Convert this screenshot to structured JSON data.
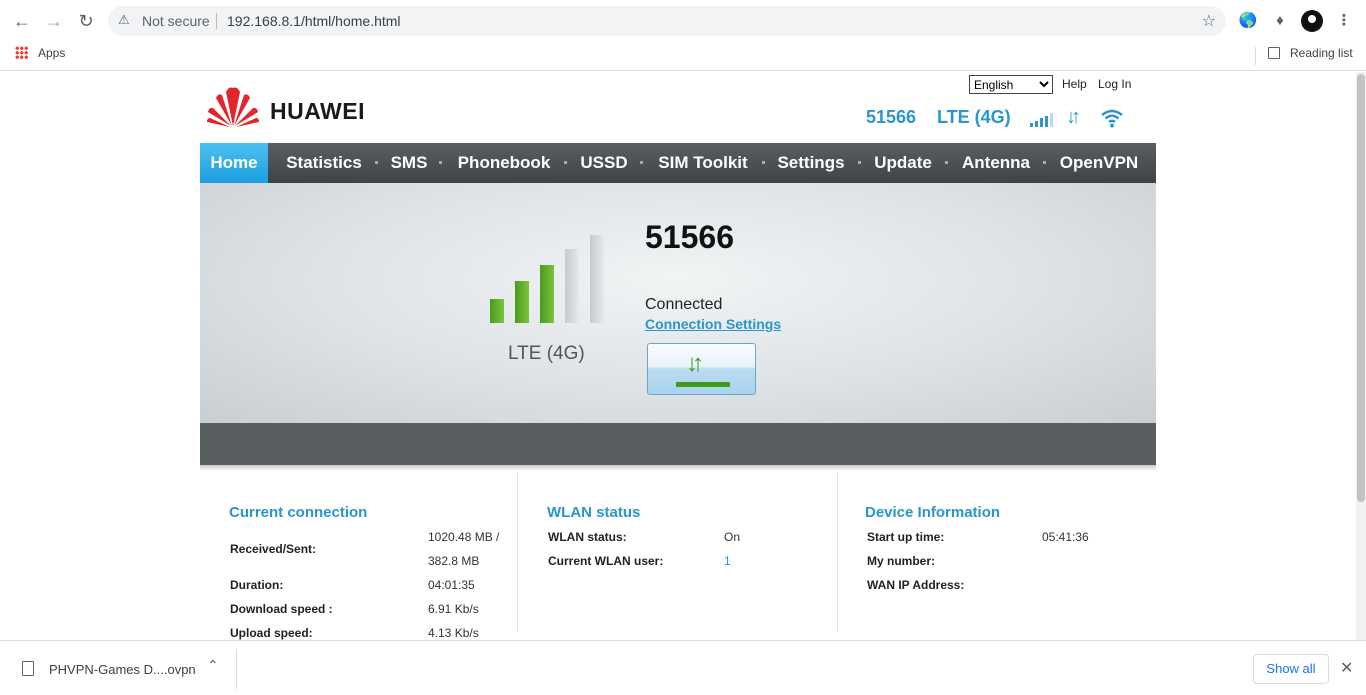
{
  "browser": {
    "security_label": "Not secure",
    "url": "192.168.8.1/html/home.html",
    "bookmarks_apps": "Apps",
    "reading_list": "Reading list"
  },
  "header": {
    "brand": "HUAWEI",
    "language": "English",
    "help": "Help",
    "login": "Log In",
    "operator": "51566",
    "network_type": "LTE (4G)"
  },
  "nav": [
    {
      "label": "Home",
      "active": true
    },
    {
      "label": "Statistics"
    },
    {
      "label": "SMS"
    },
    {
      "label": "Phonebook"
    },
    {
      "label": "USSD"
    },
    {
      "label": "SIM Toolkit"
    },
    {
      "label": "Settings"
    },
    {
      "label": "Update"
    },
    {
      "label": "Antenna"
    },
    {
      "label": "OpenVPN"
    }
  ],
  "hero": {
    "operator": "51566",
    "network_type": "LTE (4G)",
    "status": "Connected",
    "settings_link": "Connection Settings",
    "signal_level": 3,
    "signal_max": 5
  },
  "current_connection": {
    "title": "Current connection",
    "received_sent_label": "Received/Sent:",
    "received_value": "1020.48 MB /",
    "sent_value": "382.8 MB",
    "duration_label": "Duration:",
    "duration_value": "04:01:35",
    "download_label": "Download speed :",
    "download_value": "6.91 Kb/s",
    "upload_label": "Upload speed:",
    "upload_value": "4.13 Kb/s"
  },
  "wlan_status": {
    "title": "WLAN status",
    "status_label": "WLAN status:",
    "status_value": "On",
    "users_label": "Current WLAN user:",
    "users_value": "1"
  },
  "device_info": {
    "title": "Device Information",
    "startup_label": "Start up time:",
    "startup_value": "05:41:36",
    "number_label": "My number:",
    "wan_label": "WAN IP Address:"
  },
  "downloads": {
    "file": "PHVPN-Games D....ovpn",
    "show_all": "Show all"
  },
  "colors": {
    "accent": "#2a96cc",
    "nav_bg": "#4a4e52",
    "nav_active": "#1b9ee0",
    "signal_green": "#5aa826"
  }
}
